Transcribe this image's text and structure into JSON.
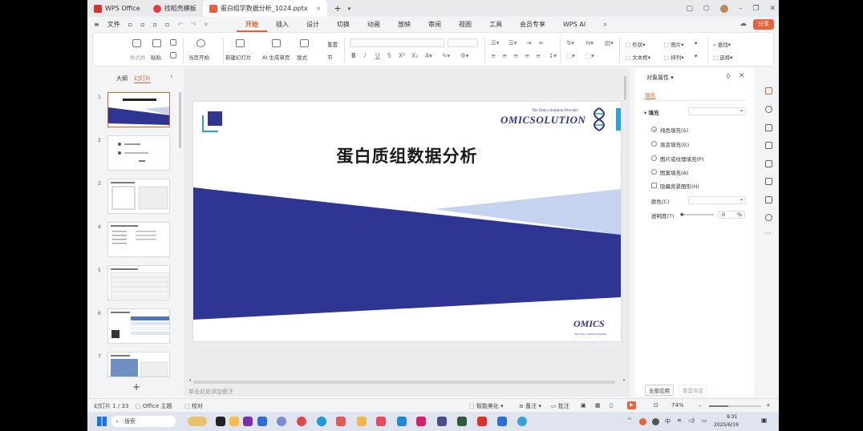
{
  "tabs": [
    {
      "label": "WPS Office",
      "active": false
    },
    {
      "label": "找稻壳模板",
      "active": false
    },
    {
      "label": "蛋白组学数据分析_1024.pptx",
      "active": true
    }
  ],
  "menu": {
    "file": "文件",
    "tabs": [
      "开始",
      "插入",
      "设计",
      "切换",
      "动画",
      "放映",
      "审阅",
      "视图",
      "工具",
      "会员专享",
      "WPS AI"
    ],
    "active_tab": "开始",
    "share": "分享"
  },
  "ribbon": {
    "format_painter": "格式刷",
    "paste": "粘贴",
    "from_current": "当页开始",
    "new_slide": "新建幻灯片",
    "ai_slide": "AI 生成单页",
    "layout": "版式",
    "reset": "重置",
    "section": "节",
    "shape": "形状",
    "picture": "图片",
    "find": "查找",
    "textbox": "文本框",
    "arrange": "排列",
    "select": "选择"
  },
  "left_panel": {
    "tabs": [
      "大纲",
      "幻灯片"
    ],
    "active_tab": "幻灯片",
    "slide_numbers": [
      "1",
      "2",
      "3",
      "4",
      "5",
      "6",
      "7"
    ]
  },
  "slide": {
    "title": "蛋白质组数据分析",
    "logo_tagline": "The Omics Solution Provider",
    "logo_text": "OMICSOLUTION",
    "footer_logo": "OMICS",
    "footer_tagline": "The Omics Solution Provider",
    "colors": {
      "navy": "#2e3592",
      "light_blue": "#c5d3ee",
      "cyan": "#29a3d6"
    }
  },
  "notes_placeholder": "单击此处添加备注",
  "right_panel": {
    "title": "对象属性",
    "tab": "填充",
    "fill_label": "填充",
    "options": [
      {
        "label": "纯色填充(S)",
        "checked": true
      },
      {
        "label": "渐变填充(G)",
        "checked": false
      },
      {
        "label": "图片或纹理填充(P)",
        "checked": false
      },
      {
        "label": "图案填充(A)",
        "checked": false
      }
    ],
    "hide_bg": "隐藏背景图形(H)",
    "color_label": "颜色(C)",
    "transparency_label": "透明度(T)",
    "transparency_value": "0",
    "percent": "%",
    "apply_all": "全部应用",
    "reset_bg": "重置背景"
  },
  "status": {
    "slide_counter": "幻灯片 1 / 33",
    "theme": "Office 主题",
    "proof": "校对",
    "beautify": "智能美化",
    "notes": "备注",
    "comment": "批注",
    "zoom": "74%"
  },
  "taskbar": {
    "search": "搜索",
    "time": "9:31",
    "date": "2025/6/19"
  }
}
